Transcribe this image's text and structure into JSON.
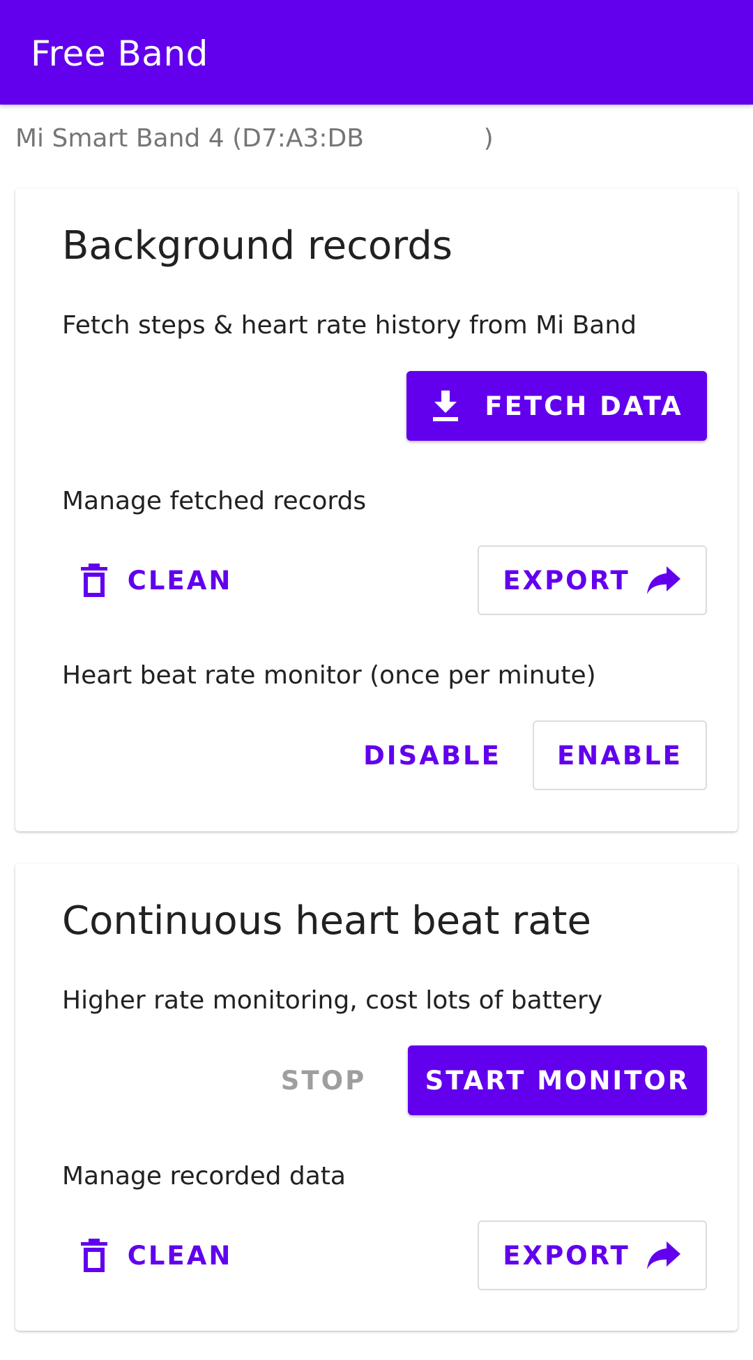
{
  "app": {
    "title": "Free Band"
  },
  "device": {
    "label": "Mi Smart Band 4 (D7:A3:DB               )"
  },
  "background_records": {
    "title": "Background records",
    "fetch_description": "Fetch steps & heart rate history from Mi Band",
    "fetch_button_label": "FETCH DATA",
    "fetch_icon": "download-icon",
    "manage_description": "Manage fetched records",
    "clean_button_label": "CLEAN",
    "clean_icon": "trash-icon",
    "export_button_label": "EXPORT",
    "export_icon": "share-arrow-icon",
    "monitor_description": "Heart beat rate monitor (once per minute)",
    "disable_button_label": "DISABLE",
    "enable_button_label": "ENABLE"
  },
  "continuous_heart_rate": {
    "title": "Continuous heart beat rate",
    "description": "Higher rate monitoring, cost lots of battery",
    "stop_button_label": "STOP",
    "start_button_label": "START MONITOR",
    "manage_description": "Manage recorded data",
    "clean_button_label": "CLEAN",
    "clean_icon": "trash-icon",
    "export_button_label": "EXPORT",
    "export_icon": "share-arrow-icon"
  },
  "colors": {
    "primary": "#6200ee",
    "text": "#212121",
    "secondary_text": "#757575",
    "disabled_text": "#9e9e9e"
  }
}
